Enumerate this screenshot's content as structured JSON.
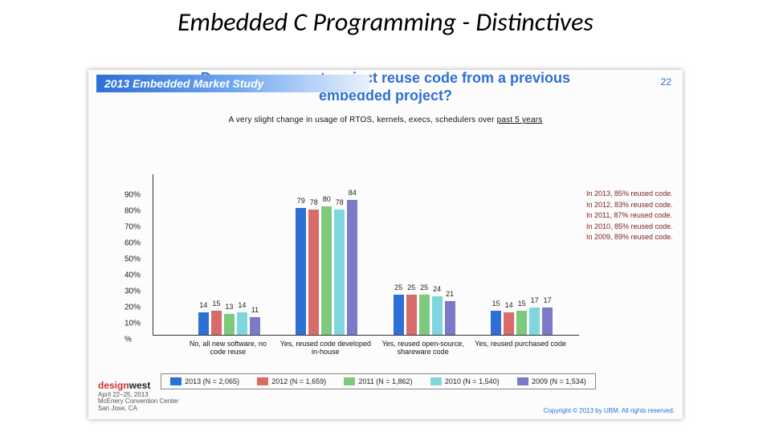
{
  "page_title": "Embedded C Programming - Distinctives",
  "banner": {
    "year": "2013",
    "rest": " Embedded Market Study"
  },
  "pagenum": "22",
  "chart_title_line1": "Does your current project reuse code from a previous",
  "chart_title_line2": "embedded project?",
  "subtitle_pre": "A very slight change in usage of RTOS, kernels, execs, schedulers over ",
  "subtitle_ul": "past 5 years",
  "chart_data": {
    "type": "bar",
    "ylabel": "%",
    "ylim": [
      0,
      100
    ],
    "yticks": [
      "%",
      "10%",
      "20%",
      "30%",
      "40%",
      "50%",
      "60%",
      "70%",
      "80%",
      "90%"
    ],
    "categories": [
      "No, all new software, no code reuse",
      "Yes, reused code developed in-house",
      "Yes, reused open-source, shareware code",
      "Yes, reused purchased code"
    ],
    "series": [
      {
        "name": "2013 (N = 2,065)",
        "year": "2013",
        "n": "2,065",
        "values": [
          14,
          79,
          25,
          15
        ]
      },
      {
        "name": "2012 (N = 1,659)",
        "year": "2012",
        "n": "1,659",
        "values": [
          15,
          78,
          25,
          14
        ]
      },
      {
        "name": "2011 (N = 1,862)",
        "year": "2011",
        "n": "1,862",
        "values": [
          13,
          80,
          25,
          15
        ]
      },
      {
        "name": "2010 (N = 1,540)",
        "year": "2010",
        "n": "1,540",
        "values": [
          14,
          78,
          24,
          17
        ]
      },
      {
        "name": "2009 (N = 1,534)",
        "year": "2009",
        "n": "1,534",
        "values": [
          11,
          84,
          21,
          17
        ]
      }
    ],
    "annotations": [
      "In 2013, 85% reused code.",
      "In 2012, 83% reused code.",
      "In 2011, 87% reused code.",
      "In 2010, 85% reused code.",
      "In 2009, 89% reused code."
    ],
    "colors": [
      "#2e6fd6",
      "#d96b6b",
      "#7dc97d",
      "#7fd6de",
      "#7a7ac8"
    ]
  },
  "logo": {
    "brand_d": "design",
    "brand_w": "west",
    "line2": "April 22–25, 2013",
    "line3": "McEnery Convention Center",
    "line4": "San Jose, CA"
  },
  "copyright": "Copyright © 2013 by UBM. All rights reserved."
}
